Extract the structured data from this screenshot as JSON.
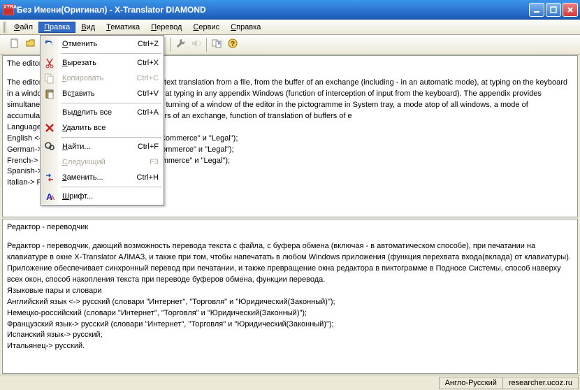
{
  "window": {
    "title": "Без Имени(Оригинал) - X-Translator DIAMOND",
    "app_icon": "XTRA"
  },
  "menubar": {
    "items": [
      "Файл",
      "Правка",
      "Вид",
      "Тематика",
      "Перевод",
      "Сервис",
      "Справка"
    ],
    "open_index": 1
  },
  "toolbar": {
    "icons": [
      {
        "name": "new-icon"
      },
      {
        "name": "open-icon"
      },
      {
        "name": "save-icon"
      },
      {
        "name": "sep"
      },
      {
        "name": "cut-icon"
      },
      {
        "name": "copy-icon"
      },
      {
        "name": "paste-icon"
      },
      {
        "name": "sep"
      },
      {
        "name": "undo-icon"
      },
      {
        "name": "translate-icon",
        "drop": true
      },
      {
        "name": "sep"
      },
      {
        "name": "dictionary-icon"
      },
      {
        "name": "sep"
      },
      {
        "name": "wrench-icon"
      },
      {
        "name": "speaker-icon",
        "disabled": true
      },
      {
        "name": "sep"
      },
      {
        "name": "bookmark-icon"
      },
      {
        "name": "help-icon"
      }
    ]
  },
  "dropdown": {
    "items": [
      {
        "icon": "undo-icon",
        "label": "Отменить",
        "accel": "Ctrl+Z",
        "ul": "О"
      },
      {
        "sep": true
      },
      {
        "icon": "cut-icon",
        "label": "Вырезать",
        "accel": "Ctrl+X",
        "ul": "В",
        "iconcolor": "#c02020"
      },
      {
        "icon": "copy-icon",
        "label": "Копировать",
        "accel": "Ctrl+C",
        "disabled": true,
        "ul": "К"
      },
      {
        "icon": "paste-icon",
        "label": "Вставить",
        "accel": "Ctrl+V",
        "ul": "т"
      },
      {
        "sep": true
      },
      {
        "icon": "",
        "label": "Выделить все",
        "accel": "Ctrl+A",
        "ul": "е"
      },
      {
        "icon": "delete-icon",
        "label": "Удалить все",
        "accel": "",
        "ul": "У",
        "iconcolor": "#c02020"
      },
      {
        "sep": true
      },
      {
        "icon": "find-icon",
        "label": "Найти...",
        "accel": "Ctrl+F",
        "ul": "Н"
      },
      {
        "icon": "",
        "label": "Следующий",
        "accel": "F3",
        "disabled": true,
        "ul": "С"
      },
      {
        "icon": "replace-icon",
        "label": "Заменить...",
        "accel": "Ctrl+H",
        "ul": "З"
      },
      {
        "sep": true
      },
      {
        "icon": "font-icon",
        "label": "Шрифт...",
        "accel": "",
        "ul": "Ш",
        "iconcolor": "#2030c0"
      }
    ]
  },
  "topPane": {
    "lines": [
      "The editor - translator",
      "",
      "The editor - translator giving an opportunity of text translation from a file, from the buffer of an exchange (including - in an automatic mode), at typing on the keyboard in a window X-Translator DIAMOND, and also at typing in any appendix Windows (function of interception of input from the keyboard). The appendix provides simultaneous interpretation at typing, and also turning of a window of the editor in the pictogramme in System tray, a mode atop of all windows, a mode of accumulation of the text while translating buffers of an exchange, function of translation of buffers of e",
      "Language pairs and dictionaries",
      "English <-> Russian (dictionaries \"Internet\", \"Commerce\" и \"Legal\");",
      "German-> Russian (dictionaries \"Internet\", \"Commerce\" и \"Legal\");",
      "French-> Russian (dictionaries \"Internet\", \"Commerce\" и \"Legal\");",
      "Spanish-> Russian;",
      "Italian-> Russian."
    ]
  },
  "bottomPane": {
    "lines": [
      "Редактор - переводчик",
      "",
      "Редактор - переводчик, дающий возможность перевода текста с файла, с буфера обмена (включая - в автоматическом способе), при печатании на клавиатуре в окне X-Translator АЛМАЗ, и также при том, чтобы напечатать в любом Windows приложения (функция перехвата входа(вклада) от клавиатуры). Приложение обеспечивает синхронный перевод при печатании, и также превращение окна редактора в пиктограмме в Подносе Системы, способ наверху всех окон, способ накопления текста при переводе буферов обмена, функции перевода.",
      "Языковые пары и словари",
      "Английский язык <-> русский (словари \"Интернет\", \"Торговля\" и \"Юридический(Законный)\");",
      "Немецко-российский (словари \"Интернет\", \"Торговля\" и \"Юридический(Законный)\");",
      "Французский язык-> русский (словари \"Интернет\", \"Торговля\" и \"Юридический(Законный)\");",
      "Испанский язык-> русский;",
      "Итальянец-> русский."
    ]
  },
  "statusbar": {
    "lang": "Англо-Русский",
    "watermark": "researcher.ucoz.ru"
  }
}
